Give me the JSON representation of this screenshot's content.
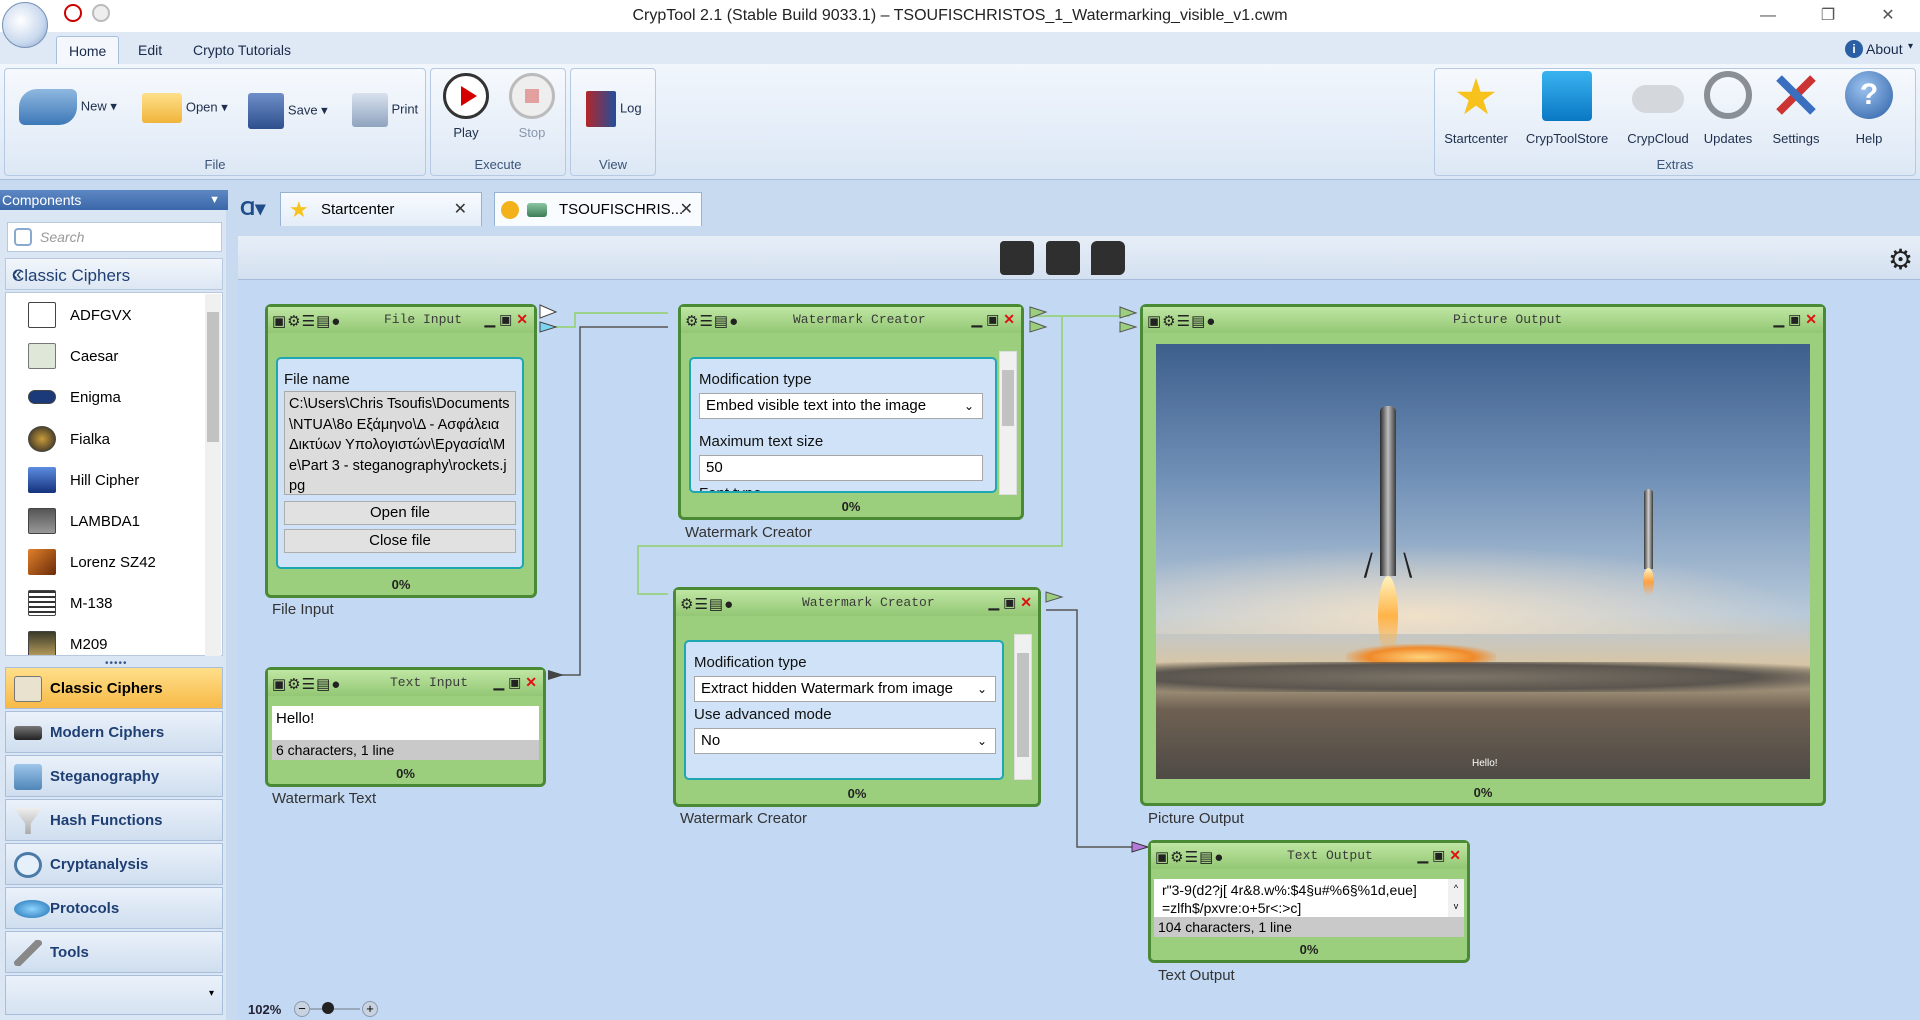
{
  "window": {
    "title": "CrypTool 2.1 (Stable Build 9033.1) – TSOUFISCHRISTOS_1_Watermarking_visible_v1.cwm",
    "controls": [
      "—",
      "❐",
      "✕"
    ]
  },
  "menu": {
    "tabs": [
      "Home",
      "Edit",
      "Crypto Tutorials"
    ],
    "about": "About"
  },
  "ribbon": {
    "file": {
      "new": "New",
      "open": "Open",
      "save": "Save",
      "print": "Print",
      "label": "File"
    },
    "execute": {
      "play": "Play",
      "stop": "Stop",
      "label": "Execute"
    },
    "view": {
      "log": "Log",
      "label": "View"
    },
    "extras": {
      "items": [
        "Startcenter",
        "CrypToolStore",
        "CrypCloud",
        "Updates",
        "Settings",
        "Help"
      ],
      "label": "Extras"
    }
  },
  "left": {
    "components_label": "Components",
    "search_placeholder": "Search",
    "section_title": "Classic Ciphers",
    "ciphers": [
      "ADFGVX",
      "Caesar",
      "Enigma",
      "Fialka",
      "Hill Cipher",
      "LAMBDA1",
      "Lorenz SZ42",
      "M-138",
      "M209"
    ],
    "categories": [
      "Classic Ciphers",
      "Modern Ciphers",
      "Steganography",
      "Hash Functions",
      "Cryptanalysis",
      "Protocols",
      "Tools"
    ],
    "zoom": "102%"
  },
  "tabs": {
    "startcenter": "Startcenter",
    "workspace": "TSOUFISCHRIS..."
  },
  "components": {
    "file_input": {
      "title": "File Input",
      "field_label": "File name",
      "path": "C:\\Users\\Chris Tsoufis\\Documents\\NTUA\\8o Εξάμηνο\\Δ - Ασφάλεια Δικτύων Υπολογιστών\\Εργασία\\Me\\Part 3 - steganography\\rockets.jpg",
      "open_btn": "Open file",
      "close_btn": "Close file",
      "progress": "0%",
      "caption": "File Input"
    },
    "text_input": {
      "title": "Text Input",
      "value": "Hello!",
      "status": "6 characters,  1 line",
      "progress": "0%",
      "caption": "Watermark Text"
    },
    "wm1": {
      "title": "Watermark Creator",
      "mod_label": "Modification type",
      "mod_value": "Embed visible text into the image",
      "size_label": "Maximum text size",
      "size_value": "50",
      "font_label": "Font type",
      "progress": "0%",
      "caption": "Watermark Creator"
    },
    "wm2": {
      "title": "Watermark Creator",
      "mod_label": "Modification type",
      "mod_value": "Extract hidden Watermark from image",
      "adv_label": "Use advanced mode",
      "adv_value": "No",
      "progress": "0%",
      "caption": "Watermark Creator"
    },
    "picture": {
      "title": "Picture Output",
      "watermark": "Hello!",
      "progress": "0%",
      "caption": "Picture Output"
    },
    "text_output": {
      "title": "Text Output",
      "line1": "r\"3-9(d2?j[ 4r&8.w%:$4§u#%6§%1d,eue]",
      "line2": "=zlfh$/pxvre:o+5r<:>c]",
      "status": "104 characters,  1 line",
      "progress": "0%",
      "caption": "Text Output"
    }
  }
}
